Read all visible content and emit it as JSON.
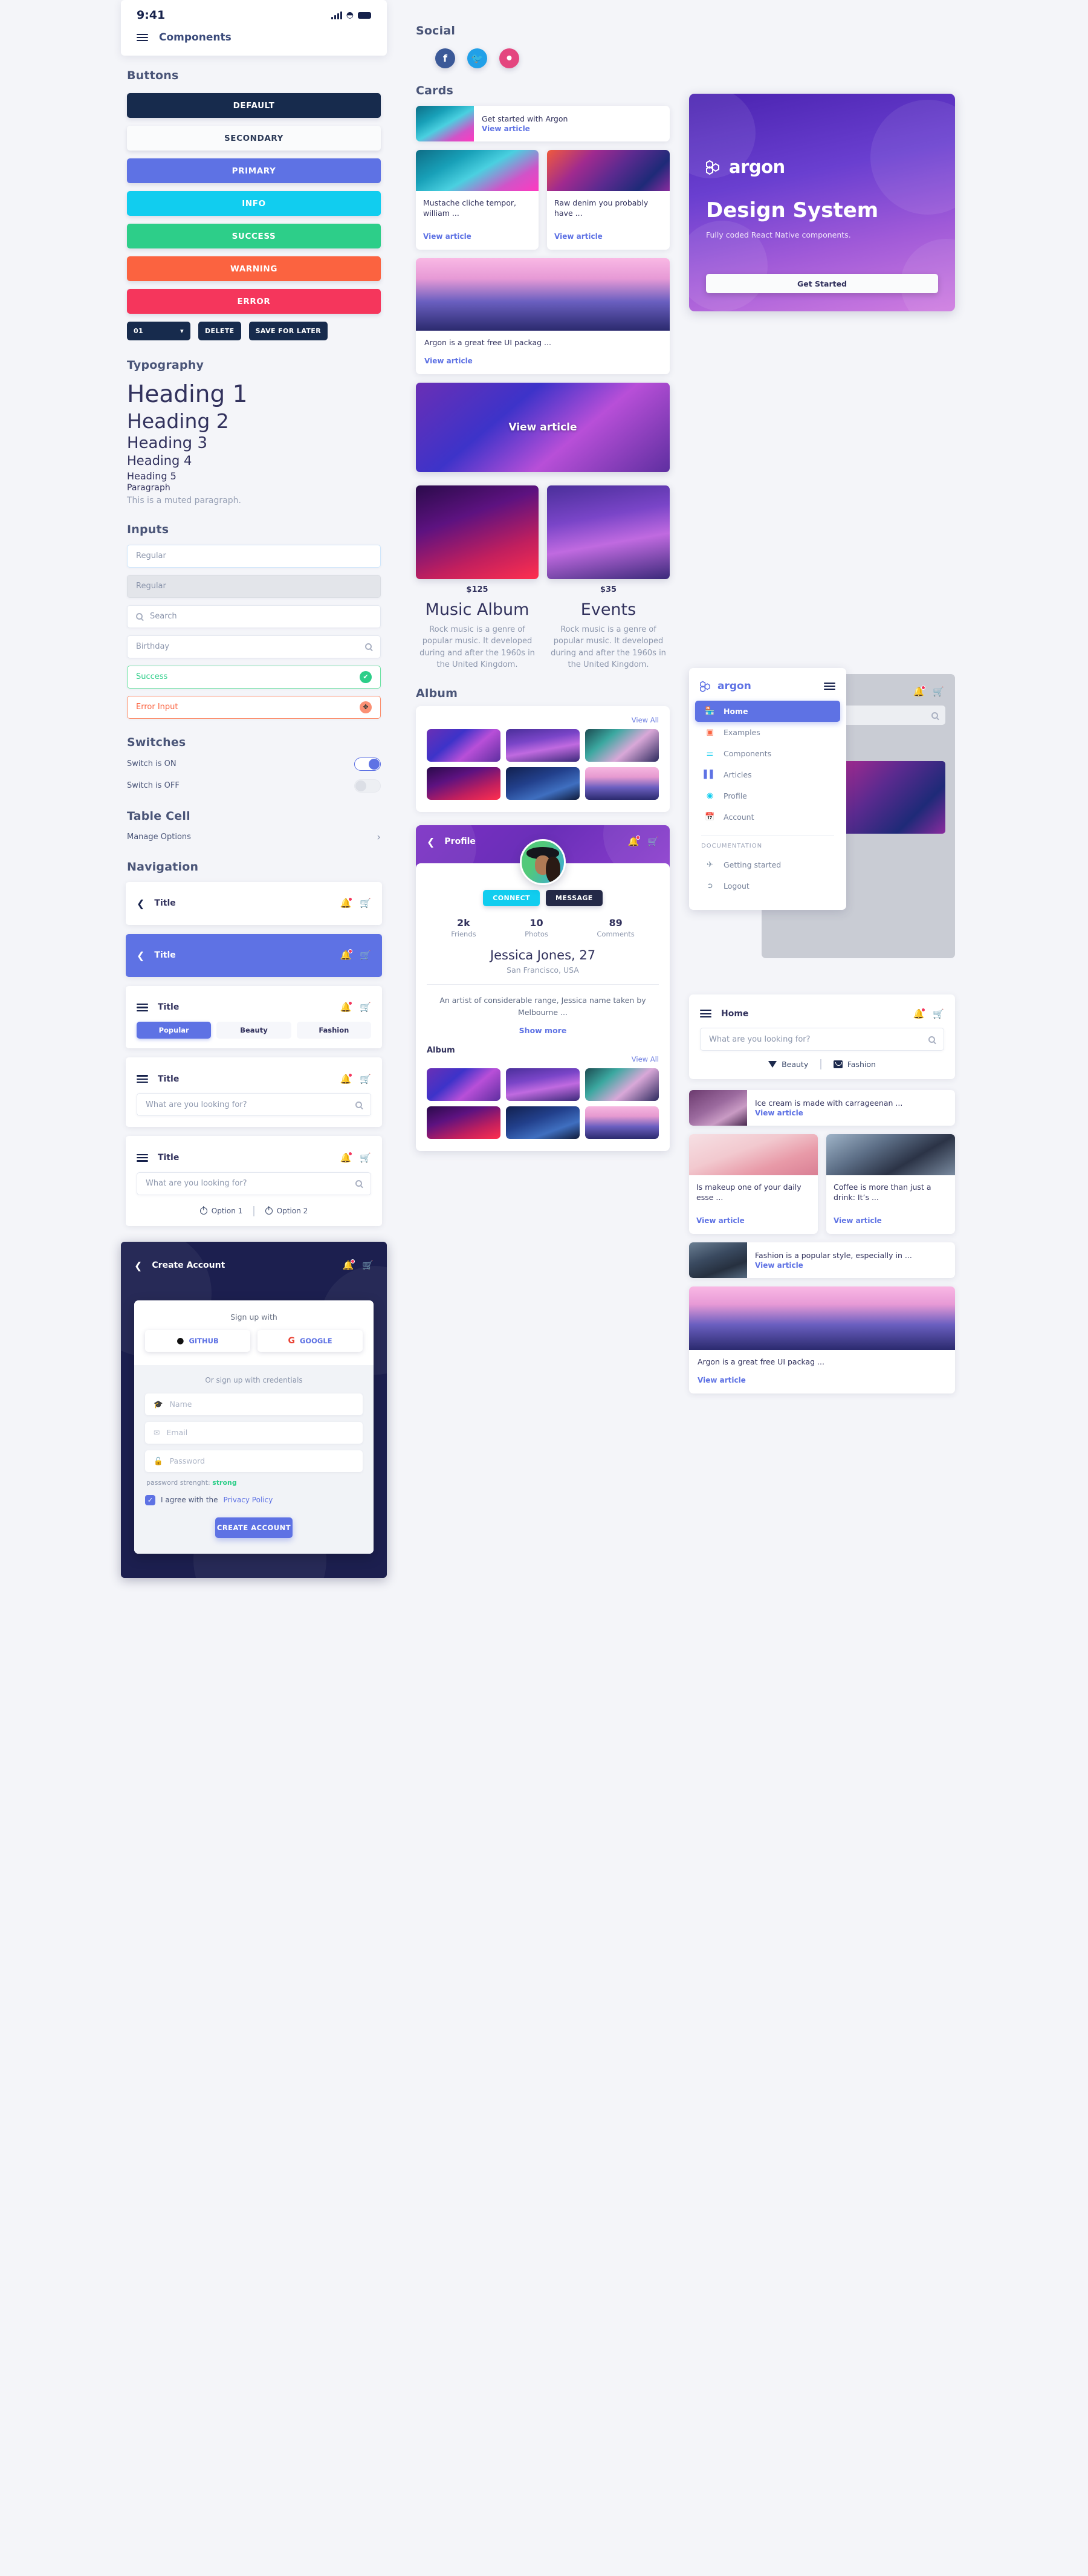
{
  "left": {
    "statusbar": {
      "time": "9:41"
    },
    "navbar": {
      "title": "Components"
    },
    "sections": {
      "buttons": "Buttons",
      "typography": "Typography",
      "inputs": "Inputs",
      "switches": "Switches",
      "table_cell": "Table Cell",
      "navigation": "Navigation"
    },
    "buttons": [
      {
        "label": "DEFAULT",
        "style": "default"
      },
      {
        "label": "SECONDARY",
        "style": "secondary"
      },
      {
        "label": "PRIMARY",
        "style": "primary"
      },
      {
        "label": "INFO",
        "style": "info"
      },
      {
        "label": "SUCCESS",
        "style": "success"
      },
      {
        "label": "WARNING",
        "style": "warning"
      },
      {
        "label": "ERROR",
        "style": "error"
      }
    ],
    "small_buttons": {
      "select_value": "01",
      "delete": "DELETE",
      "save_for_later": "SAVE FOR LATER"
    },
    "typography": {
      "h1": "Heading 1",
      "h2": "Heading 2",
      "h3": "Heading 3",
      "h4": "Heading 4",
      "h5": "Heading 5",
      "paragraph": "Paragraph",
      "muted": "This is a muted paragraph."
    },
    "inputs": [
      {
        "label": "Regular",
        "state": "focus"
      },
      {
        "label": "Regular",
        "state": "disabled"
      },
      {
        "label": "Search",
        "state": "search"
      },
      {
        "label": "Birthday",
        "state": "icon-right"
      },
      {
        "label": "Success",
        "state": "ok",
        "badge": "✔"
      },
      {
        "label": "Error Input",
        "state": "bad",
        "badge": "✥"
      }
    ],
    "switches": [
      {
        "label": "Switch is ON",
        "on": true
      },
      {
        "label": "Switch is OFF",
        "on": false
      }
    ],
    "table_cell": {
      "label": "Manage Options"
    },
    "navigation": {
      "cards": [
        {
          "title": "Title",
          "variant": "white-back"
        },
        {
          "title": "Title",
          "variant": "blue-back"
        },
        {
          "title": "Title",
          "variant": "tabs"
        },
        {
          "title": "Title",
          "variant": "search"
        },
        {
          "title": "Title",
          "variant": "search-options"
        }
      ],
      "tabs": [
        "Popular",
        "Beauty",
        "Fashion"
      ],
      "search_placeholder": "What are you looking for?",
      "options": [
        "Option 1",
        "Option 2"
      ]
    },
    "create_account": {
      "title": "Create Account",
      "sign_up_with": "Sign up with",
      "oauth": [
        "GITHUB",
        "GOOGLE"
      ],
      "or_credentials": "Or sign up with credentials",
      "fields": [
        "Name",
        "Email",
        "Password"
      ],
      "password_strength_label": "password strenght:",
      "password_strength_value": "strong",
      "agree_text": "I agree with the",
      "privacy_policy": "Privacy Policy",
      "submit": "CREATE ACCOUNT"
    }
  },
  "middle": {
    "sections": {
      "social": "Social",
      "cards": "Cards",
      "album": "Album"
    },
    "social": [
      {
        "name": "facebook",
        "glyph": "f"
      },
      {
        "name": "twitter",
        "glyph": "ᴠ"
      },
      {
        "name": "dribbble",
        "glyph": "●"
      }
    ],
    "cards": {
      "horizontal": {
        "title": "Get started with Argon",
        "link": "View article",
        "image": "im-city"
      },
      "pair": [
        {
          "title": "Mustache cliche tempor, william ...",
          "link": "View article",
          "image": "im-city"
        },
        {
          "title": "Raw denim you probably have ...",
          "link": "View article",
          "image": "im-facade"
        }
      ],
      "wide": {
        "title": "Argon is a great free UI packag ...",
        "link": "View article",
        "image": "im-mount"
      },
      "overlay": {
        "label": "View article",
        "image": "im-dance"
      }
    },
    "pricing": [
      {
        "price": "$125",
        "title": "Music Album",
        "desc": "Rock music is a genre of popular music. It developed during and after the 1960s in the United Kingdom.",
        "image": "im-dj"
      },
      {
        "price": "$35",
        "title": "Events",
        "desc": "Rock music is a genre of popular music. It developed during and after the 1960s in the United Kingdom.",
        "image": "im-hall"
      }
    ],
    "album": {
      "view_all": "View All",
      "tiles": [
        "im-dance",
        "im-hall",
        "im-flower",
        "im-dj",
        "im-aerial",
        "im-sky"
      ]
    },
    "profile": {
      "title": "Profile",
      "connect": "CONNECT",
      "message": "MESSAGE",
      "stats": [
        {
          "value": "2k",
          "label": "Friends"
        },
        {
          "value": "10",
          "label": "Photos"
        },
        {
          "value": "89",
          "label": "Comments"
        }
      ],
      "name": "Jessica Jones, 27",
      "location": "San Francisco, USA",
      "bio": "An artist of considerable range, Jessica name taken by Melbourne ...",
      "show_more": "Show more",
      "album_label": "Album",
      "view_all": "View All",
      "tiles": [
        "im-dance",
        "im-hall",
        "im-flower",
        "im-dj",
        "im-aerial",
        "im-sky"
      ]
    }
  },
  "right": {
    "hero": {
      "logo": "argon",
      "heading": "Design System",
      "subheading": "Fully coded React Native components.",
      "cta": "Get Started"
    },
    "menu": {
      "logo": "argon",
      "items": [
        {
          "label": "Home",
          "icon": "shop-icon",
          "active": true,
          "color": "#ffffff"
        },
        {
          "label": "Examples",
          "icon": "layers-icon",
          "active": false,
          "color": "#fb6340"
        },
        {
          "label": "Components",
          "icon": "toggles-icon",
          "active": false,
          "color": "#11cdef"
        },
        {
          "label": "Articles",
          "icon": "bars-icon",
          "active": false,
          "color": "#5e72e4"
        },
        {
          "label": "Profile",
          "icon": "pie-icon",
          "active": false,
          "color": "#11cdef"
        },
        {
          "label": "Account",
          "icon": "calendar-icon",
          "active": false,
          "color": "#f5365c"
        }
      ],
      "documentation_label": "DOCUMENTATION",
      "doc_items": [
        {
          "label": "Getting started",
          "icon": "rocket-icon",
          "color": "#8898aa"
        },
        {
          "label": "Logout",
          "icon": "logout-icon",
          "color": "#8898aa"
        }
      ]
    },
    "home": {
      "title": "Home",
      "search_placeholder": "What are you looking for?",
      "categories": [
        "Beauty",
        "Fashion"
      ],
      "feed": [
        {
          "title": "Ice cream is made with carrageenan ...",
          "link": "View article",
          "image": "im-cream",
          "layout": "horizontal"
        },
        {
          "title": "Is makeup one of your daily esse ...",
          "link": "View article",
          "image": "im-makeup",
          "layout": "half"
        },
        {
          "title": "Coffee is more than just a drink: It’s ...",
          "link": "View article",
          "image": "im-coffee",
          "layout": "half"
        },
        {
          "title": "Fashion is a popular style, especially in ...",
          "link": "View article",
          "image": "im-fashion",
          "layout": "horizontal"
        },
        {
          "title": "Argon is a great free UI packag ...",
          "link": "View article",
          "image": "im-mount",
          "layout": "wide"
        }
      ]
    }
  },
  "colors": {
    "primary": "#5e72e4",
    "info": "#11cdef",
    "success": "#2dce89",
    "warning": "#fb6340",
    "error": "#f5365c",
    "dark": "#172b4d",
    "page_bg": "#f4f5f9"
  }
}
